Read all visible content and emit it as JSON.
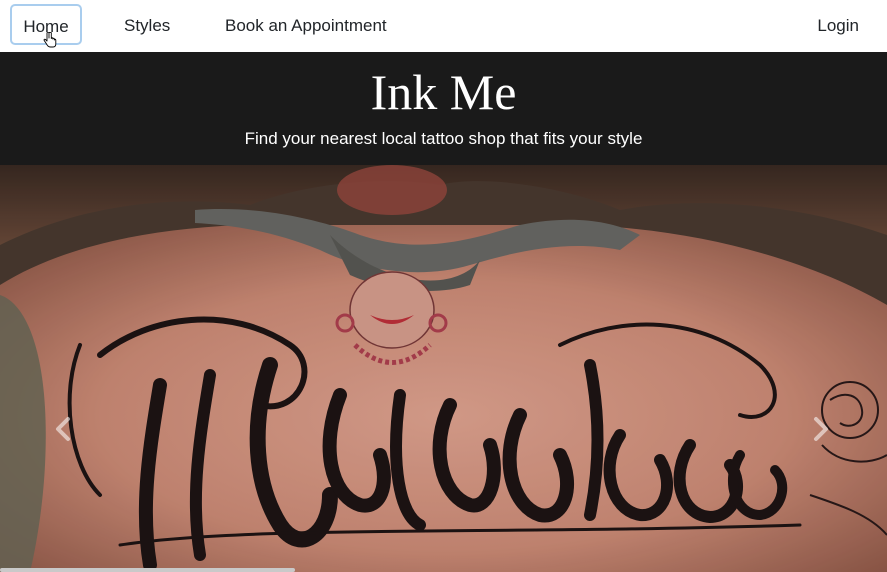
{
  "nav": {
    "home_label": "Home",
    "styles_label": "Styles",
    "book_label": "Book an Appointment",
    "login_label": "Login"
  },
  "hero": {
    "title": "Ink Me",
    "subtitle": "Find your nearest local tattoo shop that fits your style"
  },
  "carousel": {
    "prev_icon": "chevron-left-icon",
    "next_icon": "chevron-right-icon"
  },
  "colors": {
    "header_bg": "#1a1a1a",
    "focus_ring": "#a9cdee",
    "nav_text": "#212529"
  }
}
